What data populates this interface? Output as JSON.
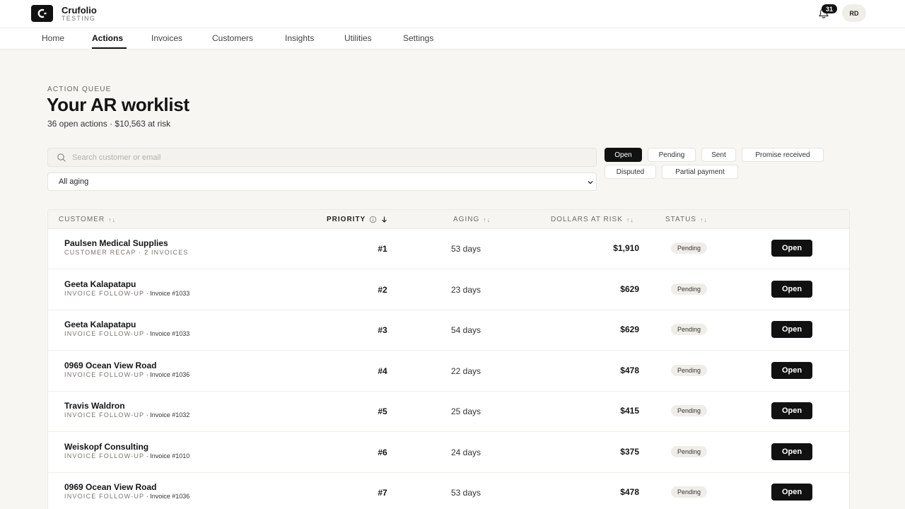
{
  "app": {
    "name": "Crufolio",
    "env": "TESTING"
  },
  "header": {
    "notification_count": "31",
    "avatar_initials": "RD"
  },
  "nav": {
    "tabs": [
      "Home",
      "Actions",
      "Invoices",
      "Customers",
      "Insights",
      "Utilities",
      "Settings"
    ],
    "active": "Actions"
  },
  "page": {
    "eyebrow": "ACTION QUEUE",
    "title": "Your AR worklist",
    "summary": "36 open actions · $10,563 at risk"
  },
  "search": {
    "placeholder": "Search customer or email",
    "value": ""
  },
  "aging_filter": {
    "selected": "All aging"
  },
  "status_filters": [
    "Open",
    "Pending",
    "Sent",
    "Promise received",
    "Disputed",
    "Partial payment"
  ],
  "status_filter_active": "Open",
  "table": {
    "columns": {
      "customer": "CUSTOMER",
      "priority": "PRIORITY",
      "aging": "AGING",
      "dollars": "DOLLARS AT RISK",
      "status": "STATUS"
    },
    "rows": [
      {
        "customer": "Paulsen Medical Supplies",
        "type": "CUSTOMER RECAP · 2 INVOICES",
        "ref": "",
        "priority": "#1",
        "aging": "53 days",
        "dollars": "$1,910",
        "status": "Pending",
        "action": "Open"
      },
      {
        "customer": "Geeta Kalapatapu",
        "type": "INVOICE FOLLOW-UP",
        "ref": " · Invoice #1033",
        "priority": "#2",
        "aging": "23 days",
        "dollars": "$629",
        "status": "Pending",
        "action": "Open"
      },
      {
        "customer": "Geeta Kalapatapu",
        "type": "INVOICE FOLLOW-UP",
        "ref": " · Invoice #1033",
        "priority": "#3",
        "aging": "54 days",
        "dollars": "$629",
        "status": "Pending",
        "action": "Open"
      },
      {
        "customer": "0969 Ocean View Road",
        "type": "INVOICE FOLLOW-UP",
        "ref": " · Invoice #1036",
        "priority": "#4",
        "aging": "22 days",
        "dollars": "$478",
        "status": "Pending",
        "action": "Open"
      },
      {
        "customer": "Travis Waldron",
        "type": "INVOICE FOLLOW-UP",
        "ref": " · Invoice #1032",
        "priority": "#5",
        "aging": "25 days",
        "dollars": "$415",
        "status": "Pending",
        "action": "Open"
      },
      {
        "customer": "Weiskopf Consulting",
        "type": "INVOICE FOLLOW-UP",
        "ref": " · Invoice #1010",
        "priority": "#6",
        "aging": "24 days",
        "dollars": "$375",
        "status": "Pending",
        "action": "Open"
      },
      {
        "customer": "0969 Ocean View Road",
        "type": "INVOICE FOLLOW-UP",
        "ref": " · Invoice #1036",
        "priority": "#7",
        "aging": "53 days",
        "dollars": "$478",
        "status": "Pending",
        "action": "Open"
      }
    ]
  },
  "icons": {
    "logo": "c-logo-icon",
    "bell": "bell-icon",
    "search": "search-icon",
    "chevron": "chevron-down-icon",
    "info": "info-icon",
    "sort": "sort-icon",
    "sort_desc": "arrow-down-icon"
  }
}
